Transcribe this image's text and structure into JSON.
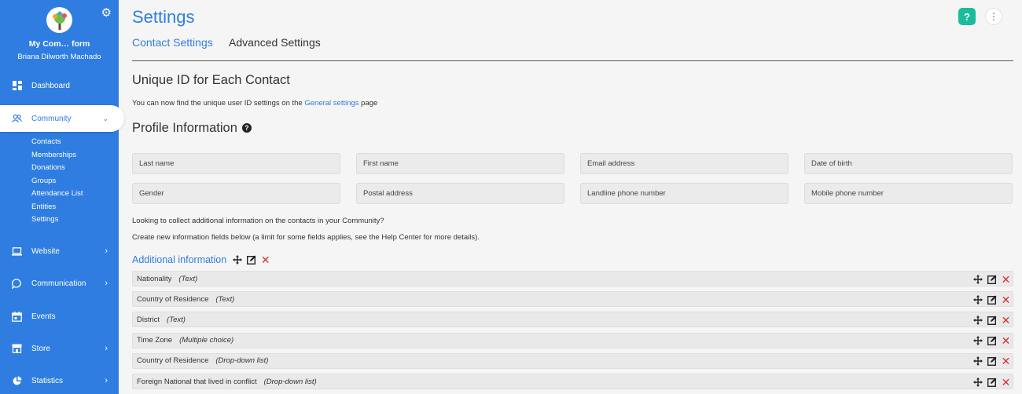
{
  "sidebar": {
    "org_name": "My Com… form",
    "user_name": "Briana Dilworth Machado",
    "items": [
      {
        "label": "Dashboard",
        "icon": "dashboard-icon"
      },
      {
        "label": "Community",
        "icon": "community-icon"
      },
      {
        "label": "Website",
        "icon": "laptop-icon"
      },
      {
        "label": "Communication",
        "icon": "chat-icon"
      },
      {
        "label": "Events",
        "icon": "calendar-icon"
      },
      {
        "label": "Store",
        "icon": "store-icon"
      },
      {
        "label": "Statistics",
        "icon": "pie-chart-icon"
      }
    ],
    "community_sub": [
      "Contacts",
      "Memberships",
      "Donations",
      "Groups",
      "Attendance List",
      "Entities",
      "Settings"
    ]
  },
  "header": {
    "title": "Settings",
    "help_label": "?",
    "tabs": [
      "Contact Settings",
      "Advanced Settings"
    ]
  },
  "unique_id": {
    "heading": "Unique ID for Each Contact",
    "text_before": "You can now find the unique user ID settings on the ",
    "link": "General settings",
    "text_after": " page"
  },
  "profile": {
    "heading": "Profile Information",
    "help_label": "?",
    "fields": [
      "Last name",
      "First name",
      "Email address",
      "Date of birth",
      "Gender",
      "Postal address",
      "Landline phone number",
      "Mobile phone number"
    ],
    "info_line_1": "Looking to collect additional information on the contacts in your Community?",
    "info_line_2": "Create new information fields below (a limit for some fields applies, see the Help Center for more details)."
  },
  "additional": {
    "title": "Additional information",
    "rows": [
      {
        "name": "Nationality",
        "type": "(Text)"
      },
      {
        "name": "Country of Residence",
        "type": "(Text)"
      },
      {
        "name": "District",
        "type": "(Text)"
      },
      {
        "name": "Time Zone",
        "type": "(Multiple choice)"
      },
      {
        "name": "Country of Residence",
        "type": "(Drop-down list)"
      },
      {
        "name": "Foreign National that lived in conflict",
        "type": "(Drop-down list)"
      }
    ]
  },
  "colors": {
    "brand": "#2f7de1",
    "help": "#1abc9c",
    "delete": "#d9302c"
  }
}
